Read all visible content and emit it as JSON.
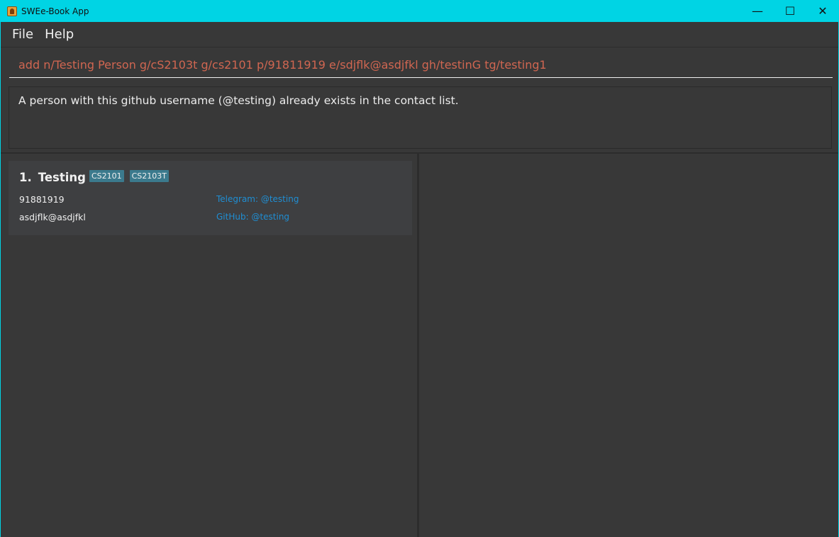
{
  "window": {
    "title": "SWEe-Book App",
    "controls": {
      "minimize": "—",
      "maximize": "☐",
      "close": "✕"
    }
  },
  "menu": {
    "items": [
      "File",
      "Help"
    ]
  },
  "command": {
    "value": "add n/Testing Person g/cS2103t g/cs2101 p/91811919 e/sdjflk@asdjfkl gh/testinG tg/testing1"
  },
  "result": {
    "message": "A person with this github username (@testing) already exists in the contact list."
  },
  "persons": [
    {
      "index": "1.",
      "name": "Testing",
      "tags": [
        "CS2101",
        "CS2103T"
      ],
      "phone": "91881919",
      "email": "asdjflk@asdjfkl",
      "telegram": "Telegram: @testing",
      "github": "GitHub: @testing"
    }
  ],
  "colors": {
    "titlebar": "#00d4e4",
    "background": "#383838",
    "card": "#3e3f41",
    "tag": "#3b7a8d",
    "command_text": "#d06651",
    "link": "#1f8ed3"
  }
}
